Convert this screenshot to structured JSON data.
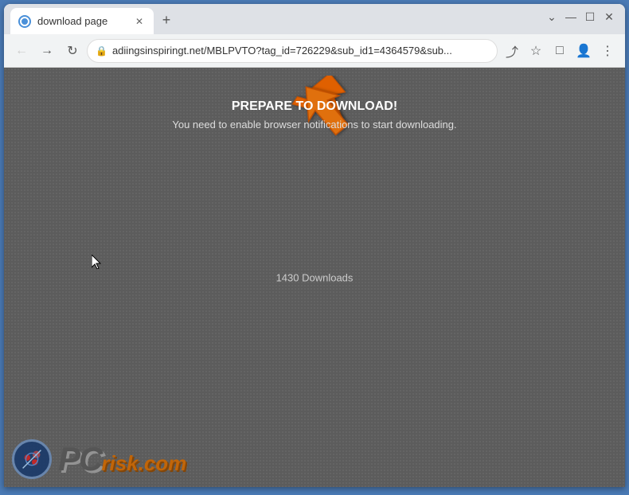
{
  "browser": {
    "tab": {
      "title": "download page",
      "favicon_label": "favicon"
    },
    "window_controls": {
      "minimize": "—",
      "maximize": "☐",
      "close": "✕",
      "chevron": "⌄"
    },
    "toolbar": {
      "back_label": "←",
      "forward_label": "→",
      "reload_label": "↻",
      "address": "adiingsinspiringt.net/MBLPVTO?tag_id=726229&sub_id1=4364579&sub...",
      "share_label": "⤴",
      "bookmark_label": "☆",
      "extensions_label": "□",
      "profile_label": "👤",
      "menu_label": "⋮"
    }
  },
  "webpage": {
    "heading": "PREPARE TO DOWNLOAD!",
    "subheading": "You need to enable browser notifications to start downloading.",
    "downloads_count": "1430 Downloads"
  },
  "watermark": {
    "pc_text": "PC",
    "risk_text": "risk.com"
  }
}
